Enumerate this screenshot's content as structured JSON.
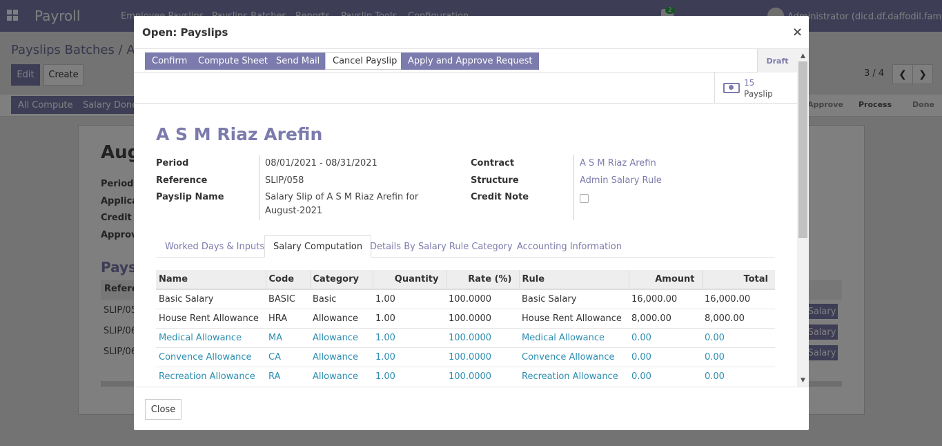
{
  "app": {
    "brand": "Payroll",
    "menu": [
      "Employee Payslips",
      "Payslips Batches",
      "Reports",
      "Payslip Tools",
      "Configuration"
    ],
    "notification_count": "2",
    "user": "Administrator (dicd.df.daffodil.family)"
  },
  "background": {
    "breadcrumb": "Payslips Batches / Aug",
    "edit_label": "Edit",
    "create_label": "Create",
    "pager": "3 / 4",
    "buttons": [
      "All Compute",
      "Salary Done"
    ],
    "statuses": [
      "Approve",
      "Process",
      "Done"
    ],
    "sheet_title": "Aug",
    "field_labels": [
      "Period",
      "Applica",
      "Credit N",
      "Approve"
    ],
    "section_title": "Pays",
    "table_header": "Refere",
    "rows": [
      "SLIP/05",
      "SLIP/06",
      "SLIP/06"
    ],
    "row_button": "Salary"
  },
  "modal": {
    "title": "Open: Payslips",
    "close_symbol": "×",
    "buttons": {
      "confirm": "Confirm",
      "compute_sheet": "Compute Sheet",
      "send_mail": "Send Mail",
      "cancel_payslip": "Cancel Payslip",
      "apply_approve": "Apply and Approve Request"
    },
    "status": "Draft",
    "smart_button": {
      "count": "15",
      "label": "Payslip",
      "icon": "money-icon"
    },
    "employee_name": "A S M Riaz Arefin",
    "fields_left": [
      {
        "label": "Period",
        "value": "08/01/2021 - 08/31/2021"
      },
      {
        "label": "Reference",
        "value": "SLIP/058"
      },
      {
        "label": "Payslip Name",
        "value_line1": "Salary Slip of A S M Riaz Arefin for",
        "value_line2": "August-2021"
      }
    ],
    "fields_right": [
      {
        "label": "Contract",
        "value": "A S M Riaz Arefin"
      },
      {
        "label": "Structure",
        "value": "Admin Salary Rule"
      },
      {
        "label": "Credit Note",
        "value": ""
      }
    ],
    "tabs": [
      "Worked Days & Inputs",
      "Salary Computation",
      "Details By Salary Rule Category",
      "Accounting Information"
    ],
    "active_tab": "Salary Computation",
    "table": {
      "headers": [
        "Name",
        "Code",
        "Category",
        "Quantity",
        "Rate (%)",
        "Rule",
        "Amount",
        "Total"
      ],
      "rows": [
        [
          "Basic Salary",
          "BASIC",
          "Basic",
          "1.00",
          "100.0000",
          "Basic Salary",
          "16,000.00",
          "16,000.00"
        ],
        [
          "House Rent Allowance",
          "HRA",
          "Allowance",
          "1.00",
          "100.0000",
          "House Rent Allowance",
          "8,000.00",
          "8,000.00"
        ],
        [
          "Medical Allowance",
          "MA",
          "Allowance",
          "1.00",
          "100.0000",
          "Medical Allowance",
          "0.00",
          "0.00"
        ],
        [
          "Convence Allowance",
          "CA",
          "Allowance",
          "1.00",
          "100.0000",
          "Convence Allowance",
          "0.00",
          "0.00"
        ],
        [
          "Recreation Allowance",
          "RA",
          "Allowance",
          "1.00",
          "100.0000",
          "Recreation Allowance",
          "0.00",
          "0.00"
        ]
      ]
    },
    "footer_close": "Close",
    "colors": {
      "primary": "#7c7bad",
      "link": "#2c8eb0"
    }
  }
}
